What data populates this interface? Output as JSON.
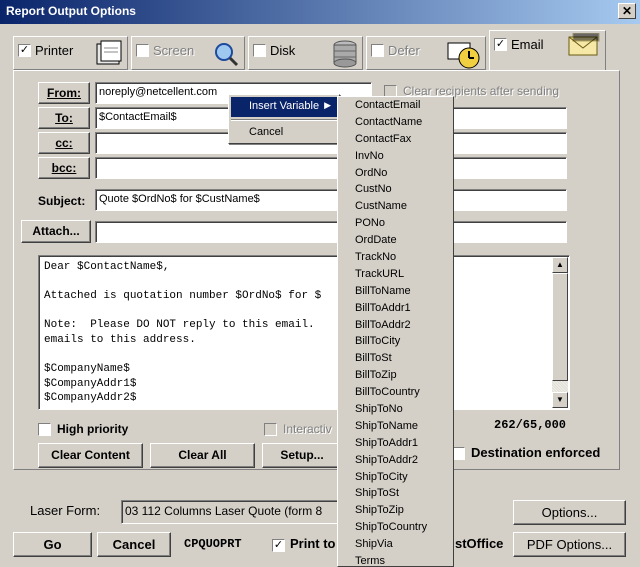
{
  "window": {
    "title": "Report Output Options",
    "close": "✕"
  },
  "tabs": [
    {
      "label": "Printer",
      "checked": "✓",
      "icon": "printer-icon"
    },
    {
      "label": "Screen",
      "checked": "",
      "icon": "magnifier-icon"
    },
    {
      "label": "Disk",
      "checked": "",
      "icon": "disk-icon"
    },
    {
      "label": "Defer",
      "checked": "",
      "icon": "clock-icon"
    },
    {
      "label": "Email",
      "checked": "✓",
      "icon": "envelope-icon"
    }
  ],
  "email": {
    "from_label": "From:",
    "from_value": "noreply@netcellent.com",
    "clear_recipients": "Clear recipients after sending",
    "to_label": "To:",
    "to_value": "$ContactEmail$",
    "cc_label": "cc:",
    "bcc_label": "bcc:",
    "subject_label": "Subject:",
    "subject_value": "Quote $OrdNo$ for $CustName$",
    "attach_label": "Attach...",
    "body": "Dear $ContactName$,\n\nAttached is quotation number $OrdNo$ for $\n\nNote:  Please DO NOT reply to this email.       r incoming\nemails to this address.\n\n$CompanyName$\n$CompanyAddr1$\n$CompanyAddr2$",
    "high_priority": "High priority",
    "interactive": "Interactiv",
    "char_count": "262/65,000",
    "clear_content": "Clear Content",
    "clear_all": "Clear All",
    "setup": "Setup...",
    "destination_enforced": "Destination enforced"
  },
  "context_menu": {
    "insert_variable": "Insert Variable",
    "cancel": "Cancel"
  },
  "variables": [
    "ContactEmail",
    "ContactName",
    "ContactFax",
    "InvNo",
    "OrdNo",
    "CustNo",
    "CustName",
    "PONo",
    "OrdDate",
    "TrackNo",
    "TrackURL",
    "BillToName",
    "BillToAddr1",
    "BillToAddr2",
    "BillToCity",
    "BillToSt",
    "BillToZip",
    "BillToCountry",
    "ShipToNo",
    "ShipToName",
    "ShipToAddr1",
    "ShipToAddr2",
    "ShipToCity",
    "ShipToSt",
    "ShipToZip",
    "ShipToCountry",
    "ShipVia",
    "Terms"
  ],
  "bottom": {
    "laser_form_label": "Laser Form:",
    "laser_form_value": "03 112 Columns Laser Quote (form 8",
    "options": "Options...",
    "go": "Go",
    "cancel": "Cancel",
    "report_code": "CPQUOPRT",
    "print_to": "Print to",
    "st_office": "stOffice",
    "pdf_options": "PDF Options..."
  }
}
